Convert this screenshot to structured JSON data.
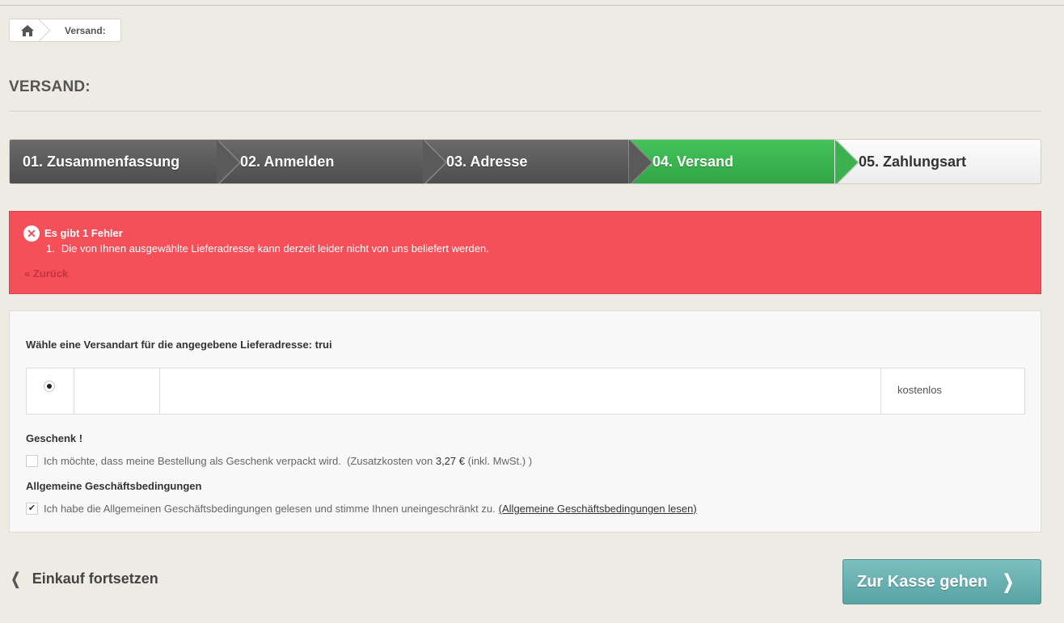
{
  "breadcrumb": {
    "home_icon": "home-icon",
    "current": "Versand:"
  },
  "page": {
    "title": "VERSAND:"
  },
  "steps": [
    {
      "label": "01. Zusammenfassung",
      "state": "done"
    },
    {
      "label": "02. Anmelden",
      "state": "done"
    },
    {
      "label": "03. Adresse",
      "state": "done"
    },
    {
      "label": "04. Versand",
      "state": "active"
    },
    {
      "label": "05. Zahlungsart",
      "state": "upcoming"
    }
  ],
  "error": {
    "icon": "close-circle-icon",
    "title": "Es gibt 1 Fehler",
    "items": [
      {
        "num": "1.",
        "text": "Die von Ihnen ausgewählte Lieferadresse kann derzeit leider nicht von uns beliefert werden."
      }
    ],
    "back_label": "« Zurück"
  },
  "shipping": {
    "heading": "Wähle eine Versandart für die angegebene Lieferadresse: trui",
    "carrier": {
      "selected": true,
      "price": "kostenlos"
    }
  },
  "gift": {
    "title": "Geschenk !",
    "label_start": "Ich möchte, dass meine Bestellung als Geschenk verpackt wird.  (Zusatzkosten von ",
    "price": "3,27 €",
    "label_end": " (inkl. MwSt.) )",
    "checked": false
  },
  "terms": {
    "title": "Allgemeine Geschäftsbedingungen",
    "label": "Ich habe die Allgemeinen Geschäftsbedingungen gelesen und stimme Ihnen uneingeschränkt zu.",
    "link": "(Allgemeine Geschäftsbedingungen lesen)",
    "checked": true
  },
  "actions": {
    "continue_label": "Einkauf fortsetzen",
    "checkout_label": "Zur Kasse gehen"
  },
  "colors": {
    "error_bg": "#f54f5a",
    "active_step": "#3bb24f",
    "checkout_btn": "#6ab1b3"
  }
}
